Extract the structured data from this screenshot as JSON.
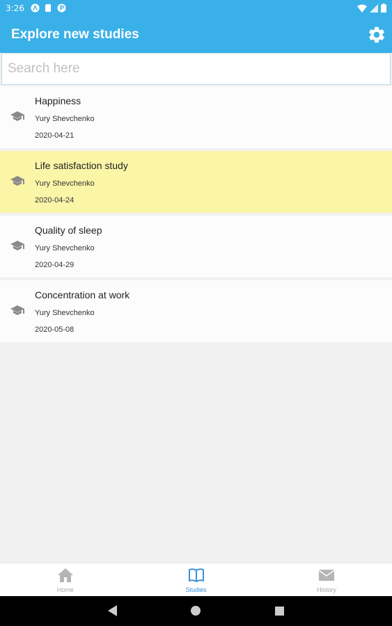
{
  "status_bar": {
    "time": "3:26",
    "icons": [
      "app-a-icon",
      "sd-card-icon",
      "app-p-icon"
    ],
    "right_icons": [
      "wifi-icon",
      "signal-icon",
      "battery-icon"
    ]
  },
  "app_bar": {
    "title": "Explore new studies",
    "settings_icon": "gear-icon",
    "color": "#3ab0e8"
  },
  "search": {
    "placeholder": "Search here",
    "value": ""
  },
  "studies": [
    {
      "name": "Happiness",
      "author": "Yury Shevchenko",
      "date": "2020-04-21",
      "highlighted": false
    },
    {
      "name": "Life satisfaction study",
      "author": "Yury Shevchenko",
      "date": "2020-04-24",
      "highlighted": true
    },
    {
      "name": "Quality of sleep",
      "author": "Yury Shevchenko",
      "date": "2020-04-29",
      "highlighted": false
    },
    {
      "name": "Concentration at work",
      "author": "Yury Shevchenko",
      "date": "2020-05-08",
      "highlighted": false
    }
  ],
  "bottom_nav": {
    "tabs": [
      {
        "label": "Home",
        "icon": "home-icon",
        "active": false
      },
      {
        "label": "Studies",
        "icon": "book-icon",
        "active": true
      },
      {
        "label": "History",
        "icon": "mail-icon",
        "active": false
      }
    ],
    "active_color": "#3a8fd6",
    "inactive_color": "#a8a8a8"
  },
  "highlight_color": "#fbf5a8"
}
